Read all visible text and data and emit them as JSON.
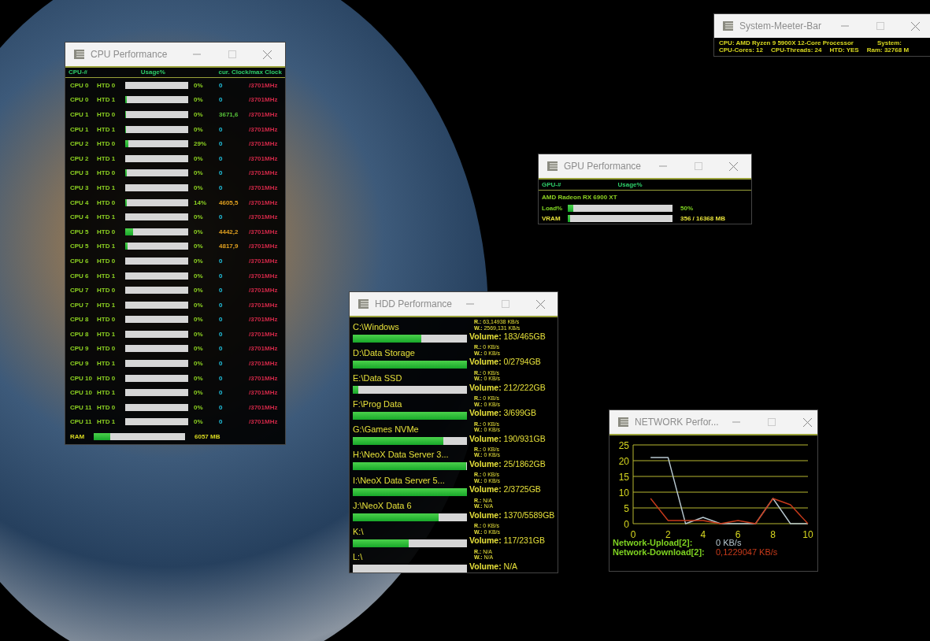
{
  "system_bar": {
    "title": "System-Meeter-Bar",
    "lines": [
      [
        {
          "text": "CPU:  AMD Ryzen 9 5900X 12-Core Processor"
        },
        {
          "text": "System:"
        }
      ],
      [
        {
          "text": "CPU-Cores:  12"
        },
        {
          "text": "CPU-Threads: 24"
        },
        {
          "text": "HTD: YES"
        },
        {
          "text": "Ram:  32768 M"
        }
      ]
    ]
  },
  "cpu_window": {
    "title": "CPU Performance",
    "columns": [
      "CPU-#",
      "Usage%",
      "cur. Clock/max Clock"
    ],
    "rows": [
      {
        "cpu": "CPU 0",
        "htd": "HTD 0",
        "level": 0,
        "usage": "0%",
        "clock": "0",
        "color": "#21c3e0",
        "max": "/3701MHz"
      },
      {
        "cpu": "CPU 0",
        "htd": "HTD 1",
        "level": 0.03,
        "usage": "0%",
        "clock": "0",
        "color": "#21c3e0",
        "max": "/3701MHz"
      },
      {
        "cpu": "CPU 1",
        "htd": "HTD 0",
        "level": 0.01,
        "usage": "0%",
        "clock": "3671,6",
        "color": "#58c33a",
        "max": "/3701MHz"
      },
      {
        "cpu": "CPU 1",
        "htd": "HTD 1",
        "level": 0.01,
        "usage": "0%",
        "clock": "0",
        "color": "#21c3e0",
        "max": "/3701MHz"
      },
      {
        "cpu": "CPU 2",
        "htd": "HTD 0",
        "level": 0.05,
        "usage": "29%",
        "clock": "0",
        "color": "#21c3e0",
        "max": "/3701MHz"
      },
      {
        "cpu": "CPU 2",
        "htd": "HTD 1",
        "level": 0,
        "usage": "0%",
        "clock": "0",
        "color": "#21c3e0",
        "max": "/3701MHz"
      },
      {
        "cpu": "CPU 3",
        "htd": "HTD 0",
        "level": 0.02,
        "usage": "0%",
        "clock": "0",
        "color": "#21c3e0",
        "max": "/3701MHz"
      },
      {
        "cpu": "CPU 3",
        "htd": "HTD 1",
        "level": 0,
        "usage": "0%",
        "clock": "0",
        "color": "#21c3e0",
        "max": "/3701MHz"
      },
      {
        "cpu": "CPU 4",
        "htd": "HTD 0",
        "level": 0.03,
        "usage": "14%",
        "clock": "4605,5",
        "color": "#e0a020",
        "max": "/3701MHz"
      },
      {
        "cpu": "CPU 4",
        "htd": "HTD 1",
        "level": 0,
        "usage": "0%",
        "clock": "0",
        "color": "#21c3e0",
        "max": "/3701MHz"
      },
      {
        "cpu": "CPU 5",
        "htd": "HTD 0",
        "level": 0.13,
        "usage": "0%",
        "clock": "4442,2",
        "color": "#e0a020",
        "max": "/3701MHz"
      },
      {
        "cpu": "CPU 5",
        "htd": "HTD 1",
        "level": 0.04,
        "usage": "0%",
        "clock": "4817,9",
        "color": "#e0a020",
        "max": "/3701MHz"
      },
      {
        "cpu": "CPU 6",
        "htd": "HTD 0",
        "level": 0,
        "usage": "0%",
        "clock": "0",
        "color": "#21c3e0",
        "max": "/3701MHz"
      },
      {
        "cpu": "CPU 6",
        "htd": "HTD 1",
        "level": 0,
        "usage": "0%",
        "clock": "0",
        "color": "#21c3e0",
        "max": "/3701MHz"
      },
      {
        "cpu": "CPU 7",
        "htd": "HTD 0",
        "level": 0,
        "usage": "0%",
        "clock": "0",
        "color": "#21c3e0",
        "max": "/3701MHz"
      },
      {
        "cpu": "CPU 7",
        "htd": "HTD 1",
        "level": 0,
        "usage": "0%",
        "clock": "0",
        "color": "#21c3e0",
        "max": "/3701MHz"
      },
      {
        "cpu": "CPU 8",
        "htd": "HTD 0",
        "level": 0,
        "usage": "0%",
        "clock": "0",
        "color": "#21c3e0",
        "max": "/3701MHz"
      },
      {
        "cpu": "CPU 8",
        "htd": "HTD 1",
        "level": 0,
        "usage": "0%",
        "clock": "0",
        "color": "#21c3e0",
        "max": "/3701MHz"
      },
      {
        "cpu": "CPU 9",
        "htd": "HTD 0",
        "level": 0,
        "usage": "0%",
        "clock": "0",
        "color": "#21c3e0",
        "max": "/3701MHz"
      },
      {
        "cpu": "CPU 9",
        "htd": "HTD 1",
        "level": 0,
        "usage": "0%",
        "clock": "0",
        "color": "#21c3e0",
        "max": "/3701MHz"
      },
      {
        "cpu": "CPU 10",
        "htd": "HTD 0",
        "level": 0,
        "usage": "0%",
        "clock": "0",
        "color": "#21c3e0",
        "max": "/3701MHz"
      },
      {
        "cpu": "CPU 10",
        "htd": "HTD 1",
        "level": 0,
        "usage": "0%",
        "clock": "0",
        "color": "#21c3e0",
        "max": "/3701MHz"
      },
      {
        "cpu": "CPU 11",
        "htd": "HTD 0",
        "level": 0,
        "usage": "0%",
        "clock": "0",
        "color": "#21c3e0",
        "max": "/3701MHz"
      },
      {
        "cpu": "CPU 11",
        "htd": "HTD 1",
        "level": 0,
        "usage": "0%",
        "clock": "0",
        "color": "#21c3e0",
        "max": "/3701MHz"
      }
    ],
    "ram": {
      "label": "RAM",
      "level": 0.18,
      "value": "6057 MB"
    }
  },
  "gpu_window": {
    "title": "GPU Performance",
    "columns": [
      "GPU-#",
      "Usage%"
    ],
    "name": "AMD Radeon RX 6900 XT",
    "rows": [
      {
        "label": "Load%",
        "level": 0.05,
        "value": "50%",
        "kind": "usage"
      },
      {
        "label": "VRAM",
        "level": 0.02,
        "value": "356 / 16368 MB",
        "kind": "memory"
      }
    ]
  },
  "hdd_window": {
    "title": "HDD Performance",
    "drives": [
      {
        "name": "C:\\Windows",
        "level": 0.6,
        "read": "**R.:** 63,14938 KB/s",
        "write": "**W.:** 2569,131 KB/s",
        "volume": "**Volume:** 183/465GB"
      },
      {
        "name": "D:\\Data Storage",
        "level": 1,
        "read": "**R.:** 0 KB/s",
        "write": "**W.:** 0 KB/s",
        "volume": "**Volume:** 0/2794GB"
      },
      {
        "name": "E:\\Data SSD",
        "level": 0.05,
        "read": "**R.:** 0 KB/s",
        "write": "**W.:** 0 KB/s",
        "volume": "**Volume:** 212/222GB"
      },
      {
        "name": "F:\\Prog  Data",
        "level": 1,
        "read": "**R.:** 0 KB/s",
        "write": "**W.:** 0 KB/s",
        "volume": "**Volume:** 3/699GB"
      },
      {
        "name": "G:\\Games NVMe",
        "level": 0.79,
        "read": "**R.:** 0 KB/s",
        "write": "**W.:** 0 KB/s",
        "volume": "**Volume:** 190/931GB"
      },
      {
        "name": "H:\\NeoX Data Server 3...",
        "level": 0.99,
        "read": "**R.:** 0 KB/s",
        "write": "**W.:** 0 KB/s",
        "volume": "**Volume:** 25/1862GB"
      },
      {
        "name": "I:\\NeoX Data Server 5...",
        "level": 1,
        "read": "**R.:** 0 KB/s",
        "write": "**W.:** 0 KB/s",
        "volume": "**Volume:** 2/3725GB"
      },
      {
        "name": "J:\\NeoX Data 6",
        "level": 0.75,
        "read": "**R.:** N/A",
        "write": "**W.:** N/A",
        "volume": "**Volume:** 1370/5589GB"
      },
      {
        "name": "K:\\",
        "level": 0.49,
        "read": "**R.:** 0 KB/s",
        "write": "**W.:** 0 KB/s",
        "volume": "**Volume:** 117/231GB"
      },
      {
        "name": "L:\\",
        "level": 0,
        "read": "**R.:** N/A",
        "write": "**W.:** N/A",
        "volume": "**Volume:** N/A"
      }
    ]
  },
  "network_window": {
    "title": "NETWORK Perfor...",
    "chart_data": {
      "type": "line",
      "grid": true,
      "x": [
        1,
        2,
        3,
        4,
        5,
        6,
        7,
        8,
        9,
        10
      ],
      "xlim": [
        0,
        10
      ],
      "ylim": [
        0,
        25
      ],
      "xticks": [
        0,
        2,
        4,
        6,
        8,
        10
      ],
      "yticks": [
        0,
        5,
        10,
        15,
        20,
        25
      ],
      "series": [
        {
          "name": "Network-Upload[2]:",
          "color": "#b8c8d0",
          "values": [
            21,
            21,
            0,
            2,
            0,
            0,
            0,
            8,
            0,
            0
          ]
        },
        {
          "name": "Network-Download[2]:",
          "color": "#c83a1a",
          "values": [
            8,
            1,
            1,
            1,
            0,
            1,
            0,
            8,
            6,
            0
          ]
        }
      ]
    },
    "readings": [
      "0 KB/s",
      "0,1229047 KB/s"
    ]
  }
}
